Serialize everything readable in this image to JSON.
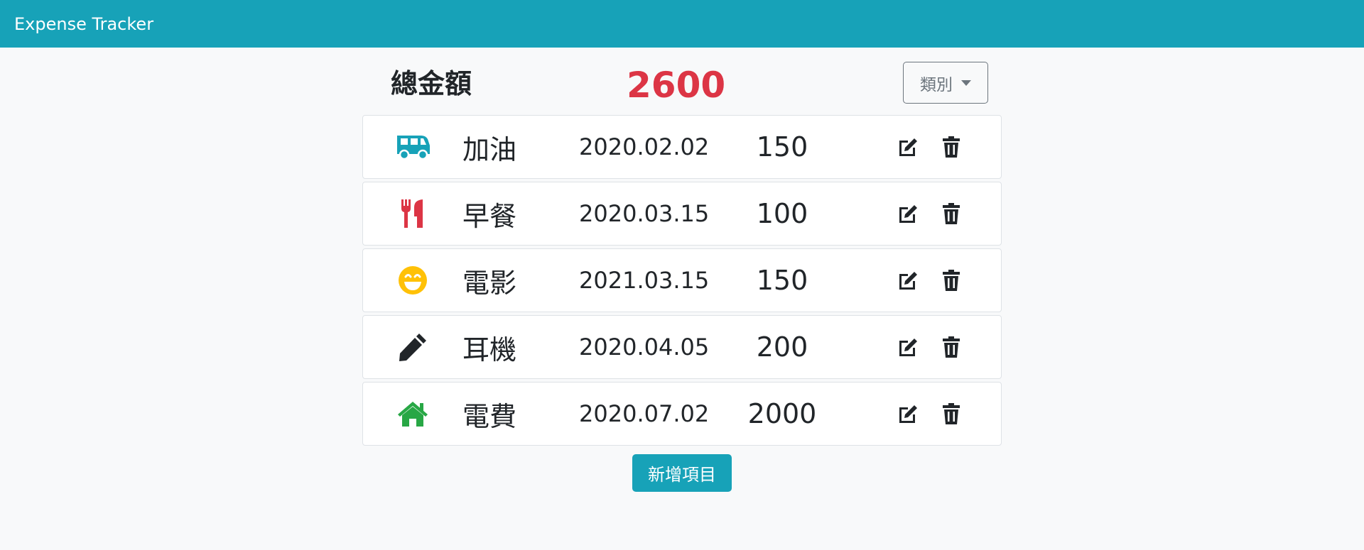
{
  "app": {
    "title": "Expense Tracker"
  },
  "summary": {
    "label": "總金額",
    "total": "2600"
  },
  "filter": {
    "label": "類別"
  },
  "records": [
    {
      "icon": "van-icon",
      "icon_color": "#17a2b8",
      "name": "加油",
      "date": "2020.02.02",
      "amount": "150"
    },
    {
      "icon": "utensils-icon",
      "icon_color": "#dc3545",
      "name": "早餐",
      "date": "2020.03.15",
      "amount": "100"
    },
    {
      "icon": "grin-icon",
      "icon_color": "#ffc107",
      "name": "電影",
      "date": "2021.03.15",
      "amount": "150"
    },
    {
      "icon": "pencil-icon",
      "icon_color": "#212529",
      "name": "耳機",
      "date": "2020.04.05",
      "amount": "200"
    },
    {
      "icon": "home-icon",
      "icon_color": "#28a745",
      "name": "電費",
      "date": "2020.07.02",
      "amount": "2000"
    }
  ],
  "actions": {
    "add_label": "新增項目"
  },
  "colors": {
    "accent": "#17a2b8",
    "total": "#dc3545",
    "background": "#f8f9fa"
  }
}
